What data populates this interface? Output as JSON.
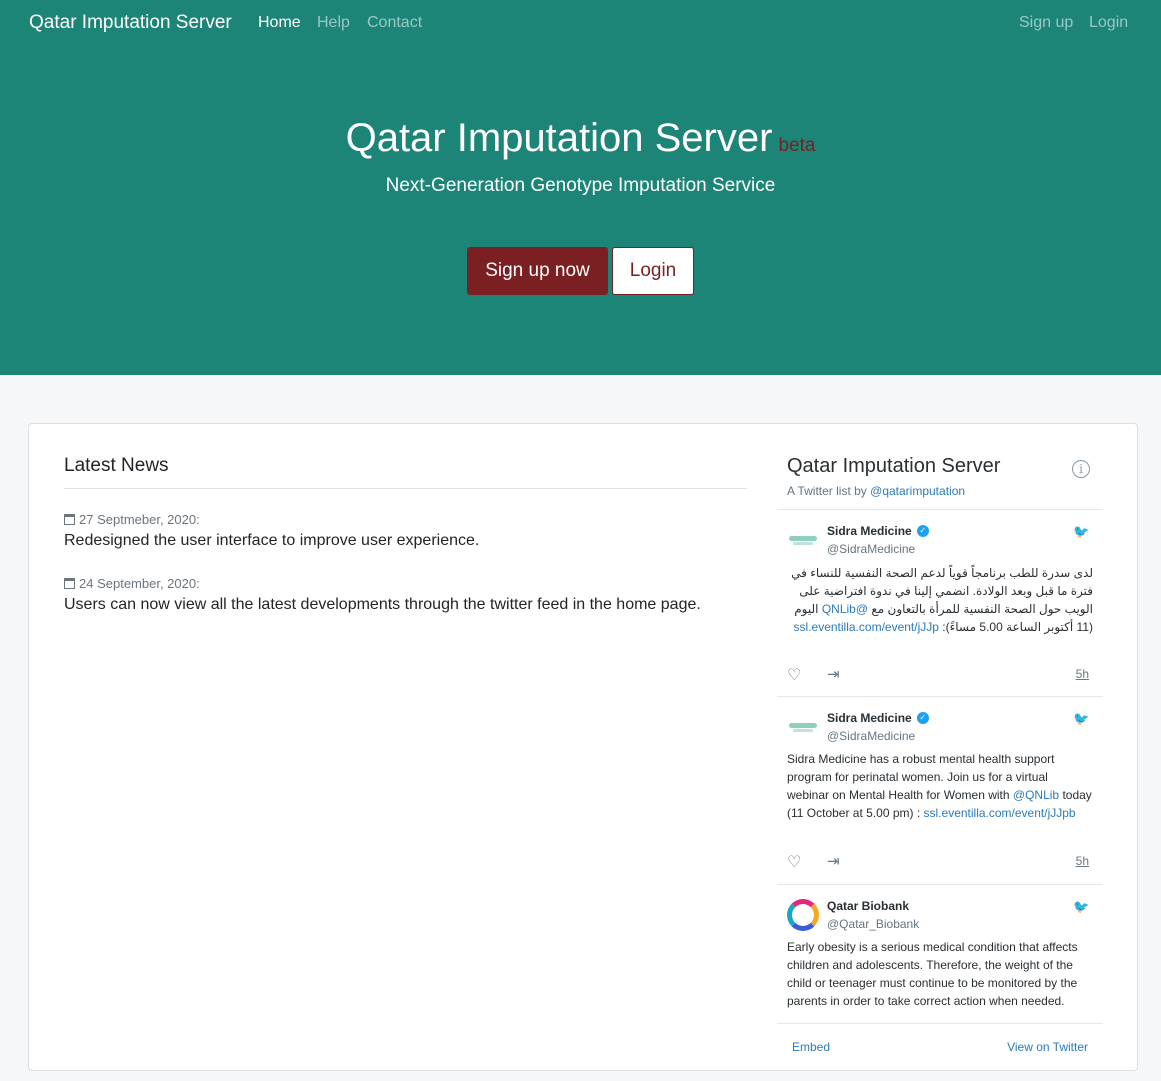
{
  "nav": {
    "brand": "Qatar Imputation Server",
    "links": [
      "Home",
      "Help",
      "Contact"
    ],
    "right_links": [
      "Sign up",
      "Login"
    ]
  },
  "hero": {
    "title": "Qatar Imputation Server",
    "badge": "beta",
    "subtitle": "Next-Generation Genotype Imputation Service",
    "primary_button": "Sign up now",
    "secondary_button": "Login"
  },
  "news": {
    "heading": "Latest News",
    "items": [
      {
        "date": "27 Septmeber, 2020:",
        "text": "Redesigned the user interface to improve user experience."
      },
      {
        "date": "24 September, 2020:",
        "text": "Users can now view all the latest developments through the twitter feed in the home page."
      }
    ]
  },
  "twitter": {
    "title": "Qatar Imputation Server",
    "byline_prefix": "A Twitter list by ",
    "byline_handle": "@qatarimputation",
    "tweets": [
      {
        "name": "Sidra Medicine",
        "handle": "@SidraMedicine",
        "text_a": "لدى سدرة للطب برنامجاً قوياً لدعم الصحة النفسية للنساء في فترة ما قبل وبعد الولادة. انضمي إلينا في ندوة افتراضية على الويب حول الصحة النفسية للمرأة بالتعاون مع",
        "mention": "@QNLib",
        "text_b": "اليوم (11 أكتوبر الساعة 5.00 مساءً):",
        "link": "ssl.eventilla.com/event/jJJp",
        "time": "5h"
      },
      {
        "name": "Sidra Medicine",
        "handle": "@SidraMedicine",
        "text_a": "Sidra Medicine has a robust mental health support program for perinatal women. Join us for a virtual webinar on Mental Health for Women with",
        "mention": "@QNLib",
        "text_b": "today (11 October at 5.00 pm) :",
        "link": "ssl.eventilla.com/event/jJJpb",
        "time": "5h"
      },
      {
        "name": "Qatar Biobank",
        "handle": "@Qatar_Biobank",
        "text_a": "Early obesity is a serious medical condition that affects children and adolescents. Therefore, the weight of the child or teenager must continue to be monitored by the parents in order to take correct action when needed."
      }
    ],
    "embed_label": "Embed",
    "view_label": "View on Twitter"
  },
  "colors": {
    "hero_bg": "#1c8577",
    "brand_maroon": "#7a1f22",
    "page_bg": "#f6f7f9",
    "twitter_link": "#2b7bb9"
  },
  "icons": [
    "calendar-icon",
    "info-icon",
    "verified-badge-icon",
    "twitter-bird-icon",
    "heart-icon",
    "share-icon"
  ]
}
